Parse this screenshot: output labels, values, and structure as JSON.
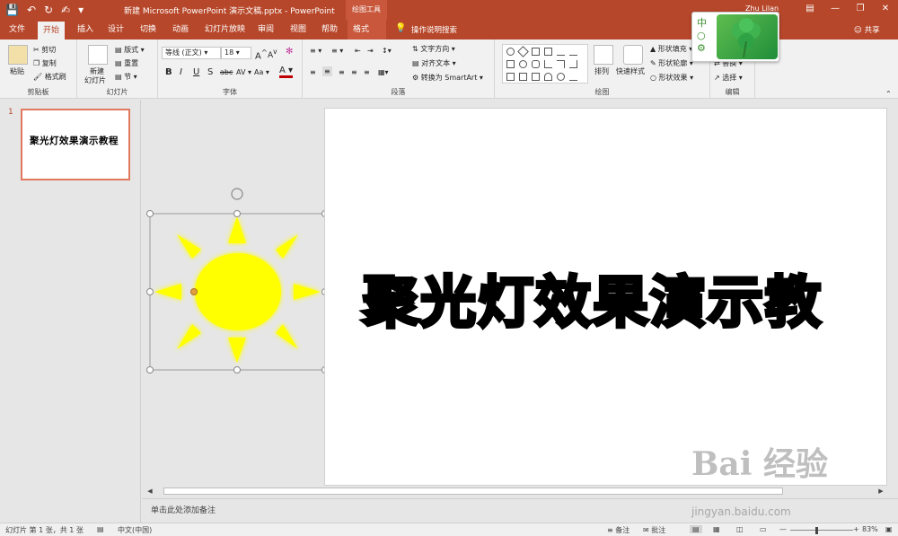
{
  "window": {
    "title": "新建 Microsoft PowerPoint 演示文稿.pptx  -  PowerPoint",
    "context_tools": "绘图工具",
    "user": "Zhu Lilan",
    "accent_color": "#b7472a"
  },
  "qat": {
    "save_icon": "save-icon",
    "undo_icon": "undo-icon",
    "redo_icon": "redo-icon",
    "customize_icon": "customize-icon"
  },
  "tabs": [
    "文件",
    "开始",
    "插入",
    "设计",
    "切换",
    "动画",
    "幻灯片放映",
    "审阅",
    "视图",
    "帮助",
    "格式"
  ],
  "active_tab": "开始",
  "tell_me": "操作说明搜索",
  "share": "共享",
  "ribbon": {
    "clipboard": {
      "label": "剪贴板",
      "paste": "粘贴",
      "cut": "剪切",
      "copy": "复制",
      "format_painter": "格式刷"
    },
    "slides": {
      "label": "幻灯片",
      "new_slide": "新建",
      "new_slide2": "幻灯片",
      "layout": "版式",
      "reset": "重置",
      "section": "节"
    },
    "font": {
      "label": "字体",
      "font_name": "等线 (正文)",
      "font_size": "18",
      "bold": "B",
      "italic": "I",
      "underline": "U",
      "shadow": "S",
      "strike": "abc",
      "spacing": "AV",
      "case": "Aa",
      "color": "A",
      "grow": "A",
      "shrink": "A"
    },
    "paragraph": {
      "label": "段落",
      "text_direction": "文字方向",
      "align_text": "对齐文本",
      "convert_smartart": "转换为 SmartArt"
    },
    "drawing": {
      "label": "绘图",
      "arrange": "排列",
      "quick_styles": "快速样式",
      "shape_fill": "形状填充",
      "shape_outline": "形状轮廓",
      "shape_effects": "形状效果"
    },
    "editing": {
      "label": "编辑",
      "replace": "替换",
      "select": "选择"
    }
  },
  "slides_panel": {
    "slide_number": "1",
    "thumb_text": "聚光灯效果演示教程"
  },
  "slide": {
    "title": "聚光灯效果演示教"
  },
  "notes": {
    "placeholder": "单击此处添加备注"
  },
  "status": {
    "slide_info": "幻灯片 第 1 张，共 1 张",
    "language": "中文(中国)",
    "notes": "备注",
    "comments": "批注",
    "zoom": "83%",
    "zoom_fraction": 0.83
  },
  "watermark": {
    "text": "Bai 经验",
    "url": "jingyan.baidu.com"
  }
}
